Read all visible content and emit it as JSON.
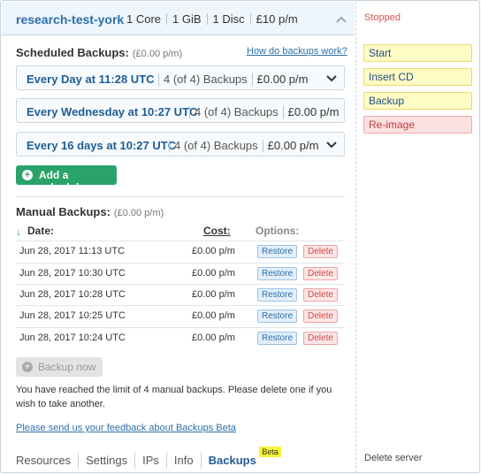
{
  "server": {
    "name": "research-test-york",
    "specs": [
      "1 Core",
      "1 GiB",
      "1 Disc",
      "£10 p/m"
    ]
  },
  "scheduled": {
    "title": "Scheduled Backups:",
    "subtitle": "(£0.00 p/m)",
    "help_link": "How do backups work?",
    "items": [
      {
        "label": "Every Day at 11:28 UTC",
        "count": "4 (of 4) Backups",
        "cost": "£0.00 p/m"
      },
      {
        "label": "Every Wednesday at 10:27 UTC",
        "count": "4 (of 4) Backups",
        "cost": "£0.00 p/m"
      },
      {
        "label": "Every 16 days at 10:27 UTC",
        "count": "4 (of 4) Backups",
        "cost": "£0.00 p/m"
      }
    ],
    "add_label": "Add a schedule"
  },
  "manual": {
    "title": "Manual Backups:",
    "subtitle": "(£0.00 p/m)",
    "columns": {
      "date": "Date:",
      "cost": "Cost:",
      "options": "Options:"
    },
    "restore_label": "Restore",
    "delete_label": "Delete",
    "rows": [
      {
        "date": "Jun 28, 2017 11:13 UTC",
        "cost": "£0.00 p/m"
      },
      {
        "date": "Jun 28, 2017 10:30 UTC",
        "cost": "£0.00 p/m"
      },
      {
        "date": "Jun 28, 2017 10:28 UTC",
        "cost": "£0.00 p/m"
      },
      {
        "date": "Jun 28, 2017 10:25 UTC",
        "cost": "£0.00 p/m"
      },
      {
        "date": "Jun 28, 2017 10:24 UTC",
        "cost": "£0.00 p/m"
      }
    ],
    "backup_now_label": "Backup now",
    "limit_text": "You have reached the limit of 4 manual backups. Please delete one if you wish to take another.",
    "feedback_link": "Please send us your feedback about Backups Beta"
  },
  "tabs": [
    {
      "label": "Resources"
    },
    {
      "label": "Settings"
    },
    {
      "label": "IPs"
    },
    {
      "label": "Info"
    },
    {
      "label": "Backups",
      "badge": "Beta"
    }
  ],
  "sidebar": {
    "status": "Stopped",
    "actions": [
      {
        "label": "Start",
        "style": "yellow"
      },
      {
        "label": "Insert CD",
        "style": "yellow"
      },
      {
        "label": "Backup",
        "style": "yellow"
      },
      {
        "label": "Re-image",
        "style": "red"
      }
    ],
    "delete_server": "Delete server"
  },
  "colors": {
    "accent_blue": "#2c6fa8",
    "add_green": "#29a36a",
    "status_red": "#d9534f",
    "action_yellow": "#fffbc5"
  }
}
